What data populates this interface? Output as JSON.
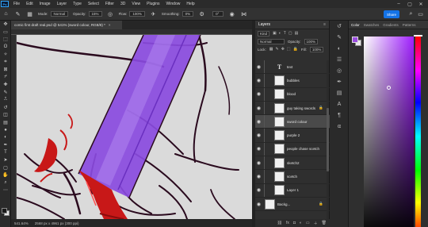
{
  "menubar": {
    "logo": "Ps",
    "items": [
      "File",
      "Edit",
      "Image",
      "Layer",
      "Type",
      "Select",
      "Filter",
      "3D",
      "View",
      "Plugins",
      "Window",
      "Help"
    ]
  },
  "options": {
    "mode_label": "Mode:",
    "mode_value": "Normal",
    "opacity_label": "Opacity:",
    "opacity_value": "15%",
    "flow_label": "Flow:",
    "flow_value": "100%",
    "smoothing_label": "Smoothing:",
    "smoothing_value": "0%",
    "angle_value": "0°",
    "share_label": "Share"
  },
  "document": {
    "tab_title": "comic first draft real.psd @ 541% (sword colour, RGB/8) *",
    "tab_close": "×"
  },
  "status": {
    "zoom": "541.64%",
    "dimensions": "2568 px x 4961 px (300 ppi)"
  },
  "layers_panel": {
    "tab_label": "Layers",
    "kind_label": "Kind",
    "blend_mode": "Normal",
    "opacity_label": "Opacity:",
    "opacity_value": "100%",
    "lock_label": "Lock:",
    "fill_label": "Fill:",
    "fill_value": "100%",
    "layers": [
      {
        "name": "text",
        "type": "text",
        "visible": true,
        "selected": false,
        "locked": false
      },
      {
        "name": "bubbles",
        "type": "pixel",
        "visible": true,
        "selected": false,
        "locked": false
      },
      {
        "name": "blood",
        "type": "pixel",
        "visible": true,
        "selected": false,
        "locked": false
      },
      {
        "name": "guy taking swords",
        "type": "pixel",
        "visible": true,
        "selected": false,
        "locked": true
      },
      {
        "name": "sword colour",
        "type": "pixel",
        "visible": true,
        "selected": true,
        "locked": false
      },
      {
        "name": "purple 2",
        "type": "pixel",
        "visible": true,
        "selected": false,
        "locked": false
      },
      {
        "name": "people chase scetch",
        "type": "pixel",
        "visible": true,
        "selected": false,
        "locked": false
      },
      {
        "name": "sketch2",
        "type": "pixel",
        "visible": true,
        "selected": false,
        "locked": false
      },
      {
        "name": "scetch",
        "type": "pixel",
        "visible": true,
        "selected": false,
        "locked": false
      },
      {
        "name": "Layer 1",
        "type": "pixel",
        "visible": true,
        "selected": false,
        "locked": false
      },
      {
        "name": "Backg...",
        "type": "pixel",
        "visible": true,
        "selected": false,
        "locked": true
      }
    ]
  },
  "color_panel": {
    "tabs": [
      "Color",
      "Swatches",
      "Gradients",
      "Patterns"
    ],
    "active_tab": "Color",
    "foreground": "#9a4ce0",
    "background": "#e8e8e8",
    "hue": "#a020ff"
  },
  "colors": {
    "accent": "#1473e6",
    "sword": "#8a4be0",
    "blood": "#c81818",
    "ink": "#2a0a1e"
  }
}
